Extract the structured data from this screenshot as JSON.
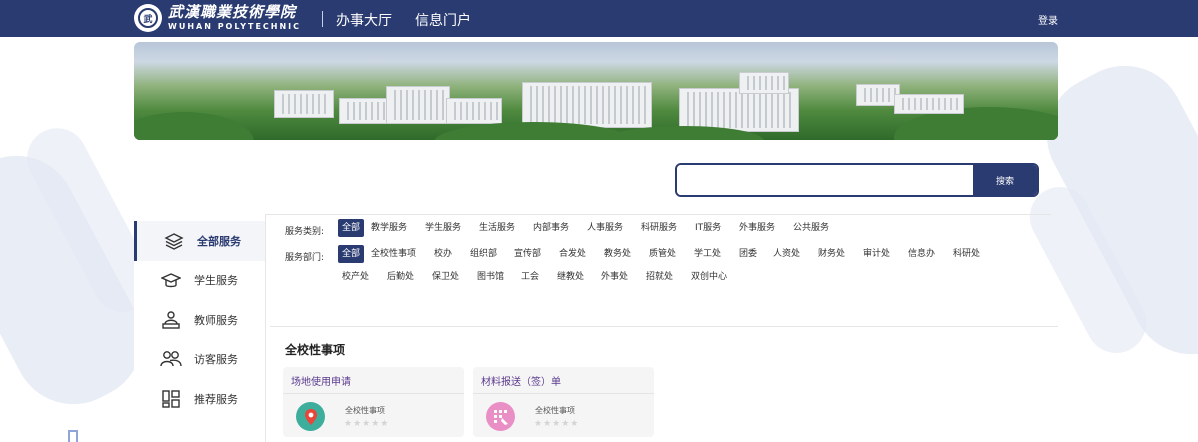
{
  "header": {
    "logo_cn": "武漢職業技術學院",
    "logo_en": "WUHAN POLYTECHNIC",
    "emblem_text": "武",
    "nav": [
      "办事大厅",
      "信息门户"
    ],
    "login": "登录"
  },
  "search": {
    "placeholder": "",
    "button": "搜索"
  },
  "sidebar": {
    "items": [
      {
        "label": "全部服务",
        "icon": "layers-icon",
        "active": true
      },
      {
        "label": "学生服务",
        "icon": "graduation-cap-icon",
        "active": false
      },
      {
        "label": "教师服务",
        "icon": "teacher-icon",
        "active": false
      },
      {
        "label": "访客服务",
        "icon": "visitors-icon",
        "active": false
      },
      {
        "label": "推荐服务",
        "icon": "grid-icon",
        "active": false
      }
    ]
  },
  "filters": {
    "category_label": "服务类别:",
    "categories": [
      "全部",
      "教学服务",
      "学生服务",
      "生活服务",
      "内部事务",
      "人事服务",
      "科研服务",
      "IT服务",
      "外事服务",
      "公共服务"
    ],
    "dept_label": "服务部门:",
    "departments_row1": [
      "全部",
      "全校性事项",
      "校办",
      "组织部",
      "宣传部",
      "合发处",
      "教务处",
      "质管处",
      "学工处",
      "团委",
      "人资处",
      "财务处",
      "审计处",
      "信息办",
      "科研处"
    ],
    "departments_row2": [
      "校产处",
      "后勤处",
      "保卫处",
      "图书馆",
      "工会",
      "继教处",
      "外事处",
      "招就处",
      "双创中心"
    ]
  },
  "section": {
    "title": "全校性事项"
  },
  "cards": [
    {
      "title": "场地使用申请",
      "category": "全校性事项",
      "icon": "map-pin-icon",
      "icon_color": "#3cae9b",
      "rating": "★★★★★"
    },
    {
      "title": "材料报送（签）单",
      "category": "全校性事项",
      "icon": "stamp-icon",
      "icon_color": "#ea8fc6",
      "rating": "★★★★★"
    }
  ],
  "colors": {
    "primary": "#2a3b71",
    "card_title": "#5b3a8e"
  }
}
